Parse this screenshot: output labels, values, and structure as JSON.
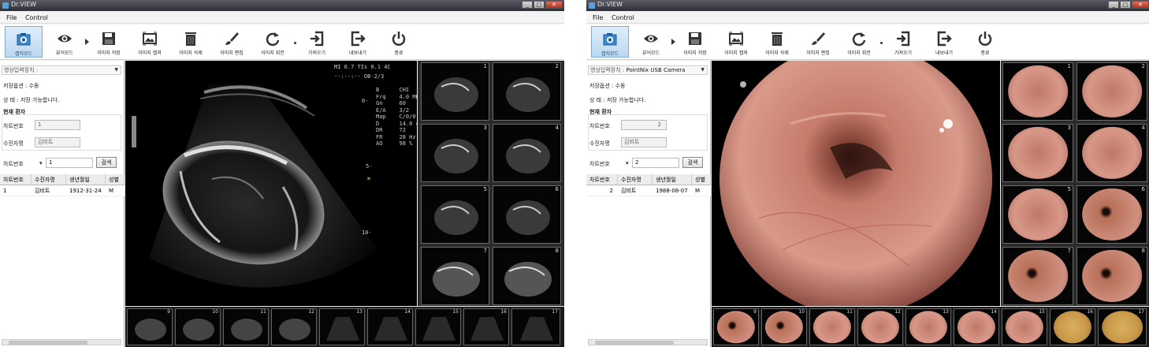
{
  "app_title": "Dr.VIEW",
  "menu": [
    "File",
    "Control"
  ],
  "toolbar": {
    "capture_mode": "캡처모드",
    "viewer_mode": "뷰어모드",
    "save_image": "이미지 저장",
    "capture_image": "이미지 캡쳐",
    "delete_image": "이미지 삭제",
    "edit_image": "이미지 편집",
    "rotate_image": "이미지 회전",
    "import": "가져오기",
    "export": "내보내기",
    "exit": "종료"
  },
  "left": {
    "device_label": "영상입력장치 :",
    "device_value": "",
    "save_option": "저장옵션 : 수동",
    "status_label": "상   태 :",
    "status_value": "저장 가능합니다.",
    "current_patient": "현재 환자",
    "chart_no_label": "차트번호",
    "chart_no_value": "1",
    "patient_name_label": "수진자명",
    "patient_name_value": "김비트",
    "search_label": "차트번호",
    "search_value": "1",
    "search_button": "검색",
    "table_headers": [
      "차트번호",
      "수진자명",
      "생년월일",
      "성별"
    ],
    "table_rows": [
      [
        "1",
        "김비트",
        "1912-31-24",
        "M"
      ]
    ]
  },
  "right": {
    "device_label": "영상입력장치 :",
    "device_value": "PointNix USB Camera",
    "save_option": "저장옵션 : 수동",
    "status_label": "상   태 :",
    "status_value": "저장 가능합니다.",
    "current_patient": "현재 환자",
    "chart_no_label": "차트번호",
    "chart_no_value": "2",
    "patient_name_label": "수진자명",
    "patient_name_value": "김비트",
    "search_label": "차트번호",
    "search_value": "2",
    "search_button": "검색",
    "table_headers": [
      "차트번호",
      "수진자명",
      "생년월일",
      "성별"
    ],
    "table_rows": [
      [
        "2",
        "김비트",
        "1988-08-07",
        "M"
      ]
    ]
  },
  "ultrasound": {
    "top_info_1": "MI 0.7   TIs 0.1  4C",
    "top_info_2": "--:--:--            OB-2/3",
    "params": "B      CHI\nFrq    4.0 MHz\nGn     60\nE/A    3/2\nMap    C/0/0\nD      14.0 cm\nDR     72\nFR     28 Hz\nAO     98 %",
    "depth_0": "0-",
    "depth_5": "5-",
    "depth_10": "10-"
  },
  "left_grid_numbers": [
    "1",
    "2",
    "3",
    "4",
    "5",
    "6",
    "7",
    "8"
  ],
  "left_strip_numbers": [
    "9",
    "10",
    "11",
    "12",
    "13",
    "14",
    "15",
    "16",
    "17"
  ],
  "right_grid_numbers": [
    "1",
    "2",
    "3",
    "4",
    "5",
    "6",
    "7",
    "8"
  ],
  "right_strip_numbers": [
    "9",
    "10",
    "11",
    "12",
    "13",
    "14",
    "15",
    "16",
    "17"
  ]
}
